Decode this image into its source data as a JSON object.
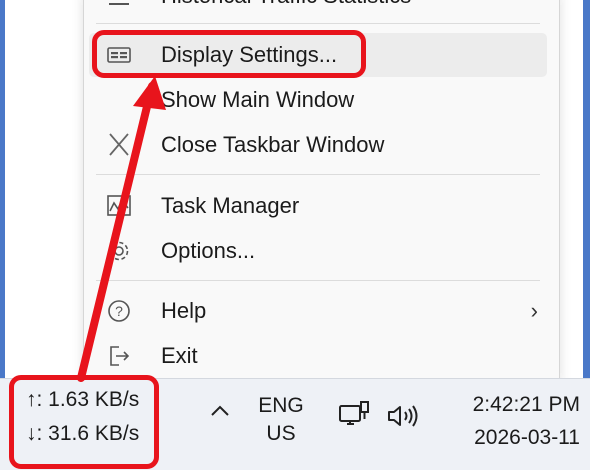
{
  "menu": {
    "items": [
      {
        "label": "Historical Traffic Statistics"
      },
      {
        "label": "Display Settings..."
      },
      {
        "label": "Show Main Window"
      },
      {
        "label": "Close Taskbar Window"
      },
      {
        "label": "Task Manager"
      },
      {
        "label": "Options..."
      },
      {
        "label": "Help",
        "submenu_arrow": "›"
      },
      {
        "label": "Exit"
      }
    ]
  },
  "taskbar": {
    "net_speed": {
      "upload": "↑: 1.63 KB/s",
      "download": "↓: 31.6 KB/s"
    },
    "language": {
      "line1": "ENG",
      "line2": "US"
    },
    "clock": {
      "time": "2:42:21 PM",
      "date": "2026-03-11"
    }
  },
  "colors": {
    "annotation": "#e8141c",
    "menu_bg": "#f9f9f9",
    "taskbar_bg": "#eef1f6",
    "frame": "#4a78c8"
  }
}
